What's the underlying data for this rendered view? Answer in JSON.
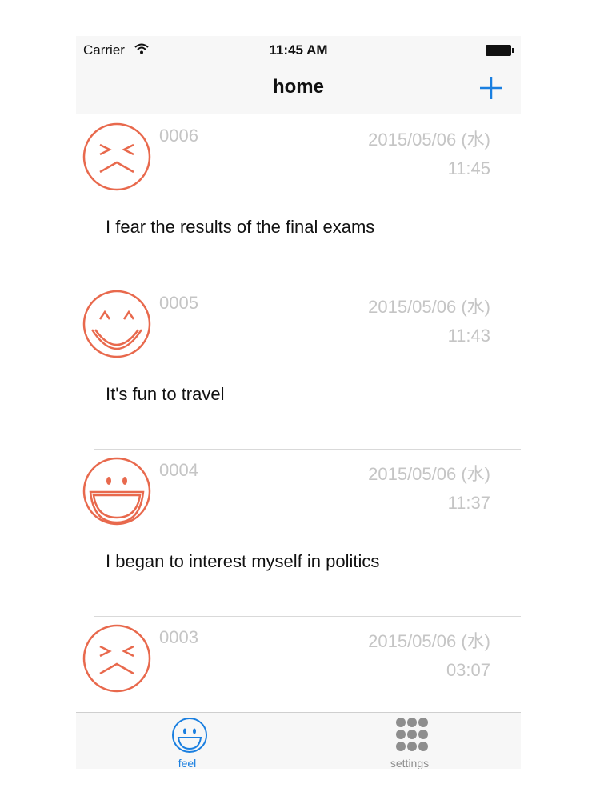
{
  "status_bar": {
    "carrier": "Carrier",
    "time": "11:45 AM"
  },
  "nav": {
    "title": "home",
    "add_icon": "plus-icon"
  },
  "colors": {
    "face": "#e8694d",
    "accent": "#1a7fe0",
    "muted": "#c5c5c5",
    "tab_inactive": "#8e8e8e"
  },
  "entries": [
    {
      "id": "0006",
      "date": "2015/05/06 (水)",
      "time": "11:45",
      "text": "I fear the results of the final exams",
      "face": "scared-face-icon"
    },
    {
      "id": "0005",
      "date": "2015/05/06 (水)",
      "time": "11:43",
      "text": "It's fun to travel",
      "face": "happy-face-icon"
    },
    {
      "id": "0004",
      "date": "2015/05/06 (水)",
      "time": "11:37",
      "text": "I began to interest myself in politics",
      "face": "laughing-face-icon"
    },
    {
      "id": "0003",
      "date": "2015/05/06 (水)",
      "time": "03:07",
      "text": "",
      "face": "scared-face-icon"
    }
  ],
  "tabs": [
    {
      "label": "feel",
      "icon": "smile-icon",
      "active": true
    },
    {
      "label": "settings",
      "icon": "dots-grid-icon",
      "active": false
    }
  ]
}
